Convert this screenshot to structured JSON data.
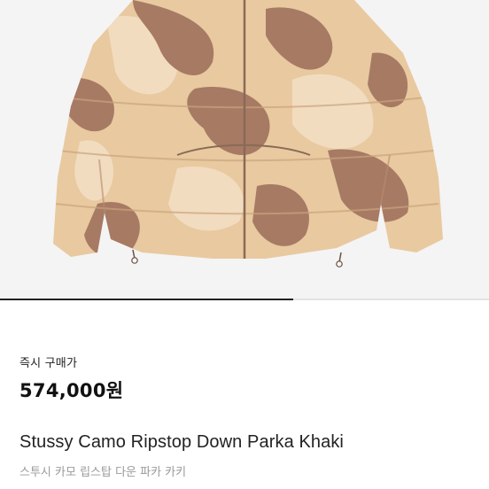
{
  "product": {
    "image_alt": "Stussy Camo Ripstop Down Parka Khaki",
    "image_progress": 0.6,
    "buy_now_label": "즉시 구매가",
    "price": "574,000원",
    "name_en": "Stussy Camo Ripstop Down Parka Khaki",
    "name_ko": "스투시 카모 립스탑 다운 파카 카키"
  },
  "colors": {
    "image_bg": "#f4f4f4",
    "camo_base": "#e9c9a0",
    "camo_brown": "#a77a64",
    "camo_light": "#f2dcc0",
    "progress_fill": "#222222",
    "progress_track": "#e3e3e3",
    "text_primary": "#111111",
    "text_secondary": "#9a9a9a"
  }
}
